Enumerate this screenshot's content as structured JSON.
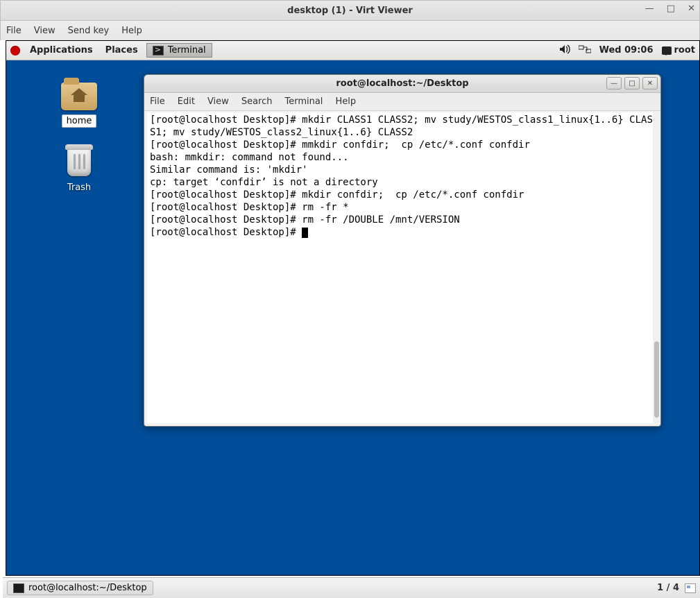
{
  "virt": {
    "title": "desktop (1) - Virt Viewer",
    "menu": {
      "file": "File",
      "view": "View",
      "sendkey": "Send key",
      "help": "Help"
    },
    "controls": {
      "min": "—",
      "max": "□",
      "close": "✕"
    }
  },
  "gnome": {
    "applications": "Applications",
    "places": "Places",
    "task_terminal": "Terminal",
    "clock": "Wed 09:06",
    "user": "root"
  },
  "desktop": {
    "home": "home",
    "trash": "Trash"
  },
  "terminal": {
    "title": "root@localhost:~/Desktop",
    "menu": {
      "file": "File",
      "edit": "Edit",
      "view": "View",
      "search": "Search",
      "terminal": "Terminal",
      "help": "Help"
    },
    "win": {
      "min": "—",
      "max": "□",
      "close": "✕"
    },
    "lines": [
      "[root@localhost Desktop]# mkdir CLASS1 CLASS2; mv study/WESTOS_class1_linux{1..6} CLASS1; mv study/WESTOS_class2_linux{1..6} CLASS2",
      "[root@localhost Desktop]# mmkdir confdir;  cp /etc/*.conf confdir",
      "bash: mmkdir: command not found...",
      "Similar command is: 'mkdir'",
      "cp: target ‘confdir’ is not a directory",
      "[root@localhost Desktop]# mkdir confdir;  cp /etc/*.conf confdir",
      "[root@localhost Desktop]# rm -fr *",
      "[root@localhost Desktop]# rm -fr /DOUBLE /mnt/VERSION",
      "[root@localhost Desktop]# "
    ]
  },
  "host_taskbar": {
    "task": "root@localhost:~/Desktop",
    "workspace": "1 / 4"
  }
}
